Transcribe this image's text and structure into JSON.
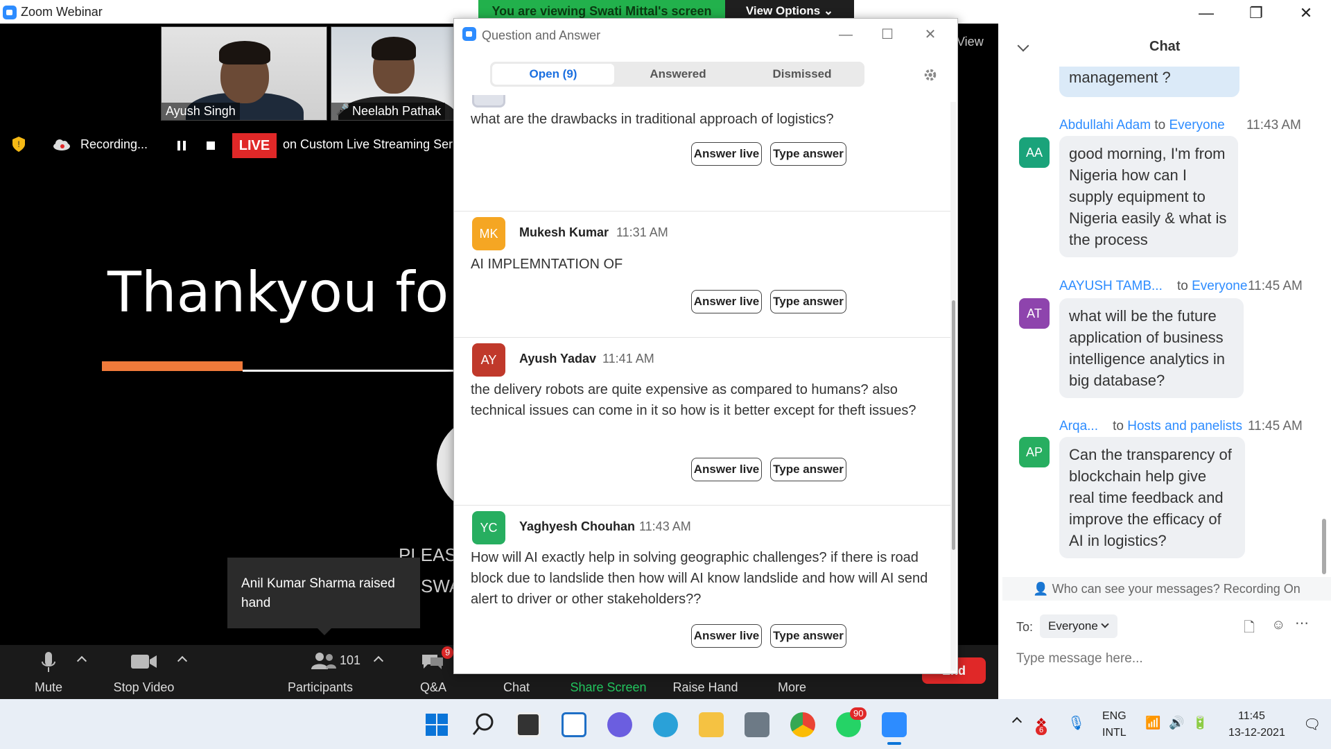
{
  "window": {
    "title": "Zoom Webinar"
  },
  "banner": {
    "viewing": "You are viewing Swati Mittal's screen",
    "view_options": "View Options"
  },
  "thumbs": [
    {
      "name": "Ayush Singh"
    },
    {
      "name": "Neelabh Pathak"
    }
  ],
  "view_label": "View",
  "recording": {
    "label": "Recording...",
    "live": "LIVE",
    "stream": "on Custom Live Streaming Ser"
  },
  "slide": {
    "title": "Thankyou for y",
    "text1": "PLEASE",
    "text2": "SWA"
  },
  "toast": {
    "text": "Anil Kumar Sharma raised hand"
  },
  "toolbar": {
    "mute": "Mute",
    "stop_video": "Stop Video",
    "participants": "Participants",
    "participants_count": "101",
    "qa": "Q&A",
    "qa_badge": "9",
    "chat": "Chat",
    "share_screen": "Share Screen",
    "raise_hand": "Raise Hand",
    "more": "More",
    "end": "End"
  },
  "qa": {
    "title": "Question and Answer",
    "tabs": [
      "Open (9)",
      "Answered",
      "Dismissed"
    ],
    "items": [
      {
        "initials": "",
        "author": "",
        "time": "",
        "text": "what are the drawbacks in traditional approach of logistics?",
        "color": "#c9ccd8"
      },
      {
        "initials": "MK",
        "author": "Mukesh Kumar",
        "time": "11:31 AM",
        "text": "AI IMPLEMNTATION OF",
        "color": "#f5a623"
      },
      {
        "initials": "AY",
        "author": "Ayush Yadav",
        "time": "11:41 AM",
        "text": "the delivery robots are quite expensive as compared to humans? also technical issues can come in it so how is it better except for theft issues?",
        "color": "#c0392b"
      },
      {
        "initials": "YC",
        "author": "Yaghyesh Chouhan",
        "time": "11:43 AM",
        "text": "How will AI exactly help in solving geographic challenges? if there is road block due to landslide then how will AI know landslide and how will AI send alert to driver or other stakeholders??",
        "color": "#27ae60"
      }
    ],
    "answer_live": "Answer live",
    "type_answer": "Type answer"
  },
  "chat": {
    "header": "Chat",
    "prev_bubble": "management ?",
    "messages": [
      {
        "initials": "AA",
        "sender": "Abdullahi Adam",
        "to": " to ",
        "recipient": "Everyone",
        "time": "11:43 AM",
        "text": "good morning,  I'm from Nigeria  how can I supply equipment to Nigeria easily & what is the process",
        "color": "#1aa37a"
      },
      {
        "initials": "AT",
        "sender": "AAYUSH TAMB...",
        "to": "to ",
        "recipient": "Everyone",
        "time": "11:45 AM",
        "text": "what will be the future application of business intelligence analytics in big database?",
        "color": "#8e44ad"
      },
      {
        "initials": "AP",
        "sender": "Arqa...",
        "to": "to ",
        "recipient": "Hosts and panelists",
        "time": "11:45 AM",
        "text": "Can the transparency of blockchain help give real time feedback and improve the efficacy of AI in logistics?",
        "color": "#27ae60"
      }
    ],
    "who_can_see": "Who can see your messages? Recording On",
    "to_label": "To:",
    "to_value": "Everyone",
    "placeholder": "Type message here..."
  },
  "taskbar": {
    "lang1": "ENG",
    "lang2": "INTL",
    "time": "11:45",
    "date": "13-12-2021",
    "whatsapp_badge": "90",
    "tray_badge": "6"
  }
}
